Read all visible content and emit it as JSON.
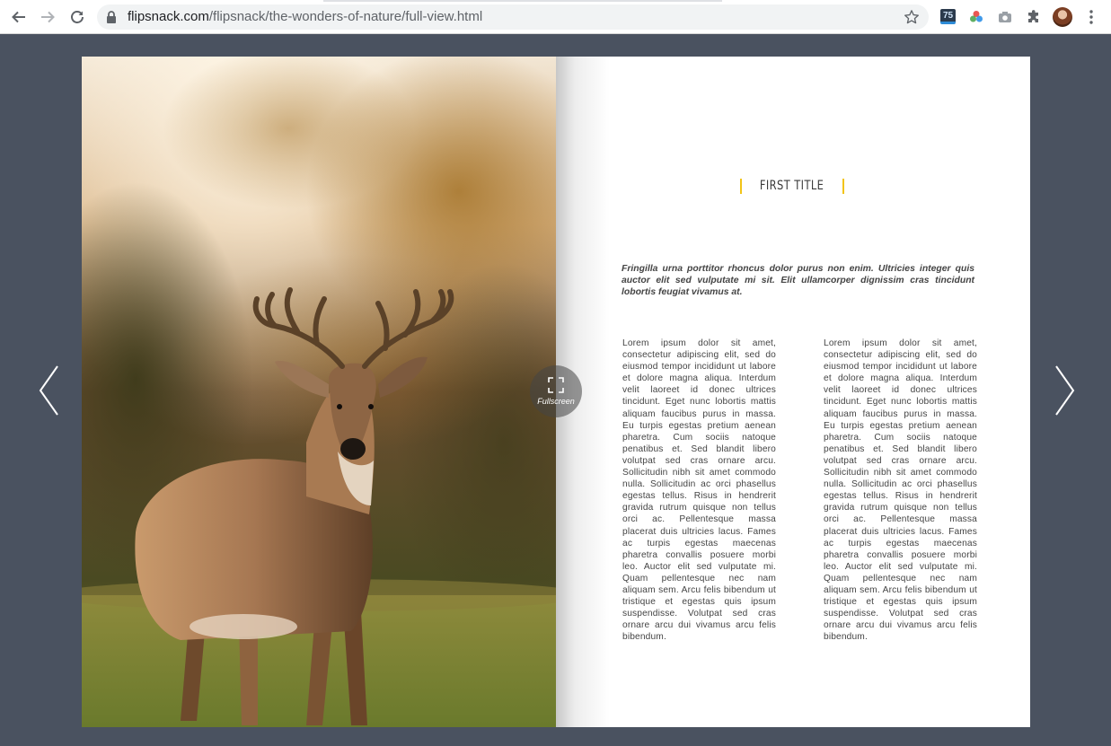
{
  "browser": {
    "url_host": "flipsnack.com",
    "url_path": "/flipsnack/the-wonders-of-nature/full-view.html",
    "extension_badge": "75",
    "icons": [
      "back-icon",
      "forward-icon",
      "reload-icon",
      "lock-icon",
      "bookmark-star-icon",
      "color-wheel-icon",
      "camera-icon",
      "puzzle-icon",
      "menu-dots-icon"
    ]
  },
  "viewer": {
    "fullscreen_label": "Fullscreen"
  },
  "page_right": {
    "title": "FIRST TITLE",
    "lead": "Fringilla urna porttitor rhoncus dolor purus non enim. Ultricies integer quis auctor elit sed vulputate mi sit. Elit ullamcorper dignissim cras tincidunt lobortis feugiat vivamus at.",
    "column1": "Lorem ipsum dolor sit amet, consectetur adipiscing elit, sed do eiusmod tempor incididunt ut labore et dolore magna aliqua. Interdum velit laoreet id donec ultrices tincidunt. Eget nunc lobortis mattis aliquam faucibus purus in massa. Eu turpis egestas pretium aenean pharetra. Cum sociis natoque penatibus et. Sed blandit libero volutpat sed cras ornare arcu. Sollicitudin nibh sit amet commodo nulla. Sollicitudin ac orci phasellus egestas tellus. Risus in hendrerit gravida rutrum quisque non tellus orci ac. Pellentesque massa placerat duis ultricies lacus. Fames ac turpis egestas maecenas pharetra convallis posuere morbi leo. Auctor elit sed vulputate mi. Quam pellentesque nec nam aliquam sem. Arcu felis bibendum ut tristique et egestas quis ipsum suspendisse. Volutpat sed cras ornare arcu dui vivamus arcu felis bibendum.",
    "column2": "Lorem ipsum dolor sit amet, consectetur adipiscing elit, sed do eiusmod tempor incididunt ut labore et dolore magna aliqua. Interdum velit laoreet id donec ultrices tincidunt. Eget nunc lobortis mattis aliquam faucibus purus in massa. Eu turpis egestas pretium aenean pharetra. Cum sociis natoque penatibus et. Sed blandit libero volutpat sed cras ornare arcu. Sollicitudin nibh sit amet commodo nulla. Sollicitudin ac orci phasellus egestas tellus. Risus in hendrerit gravida rutrum quisque non tellus orci ac. Pellentesque massa placerat duis ultricies lacus. Fames ac turpis egestas maecenas pharetra convallis posuere morbi leo. Auctor elit sed vulputate mi. Quam pellentesque nec nam aliquam sem. Arcu felis bibendum ut tristique et egestas quis ipsum suspendisse. Volutpat sed cras ornare arcu dui vivamus arcu felis bibendum."
  },
  "colors": {
    "viewer_background": "#4a5260",
    "title_accent": "#f2c417",
    "body_text": "#444444"
  }
}
